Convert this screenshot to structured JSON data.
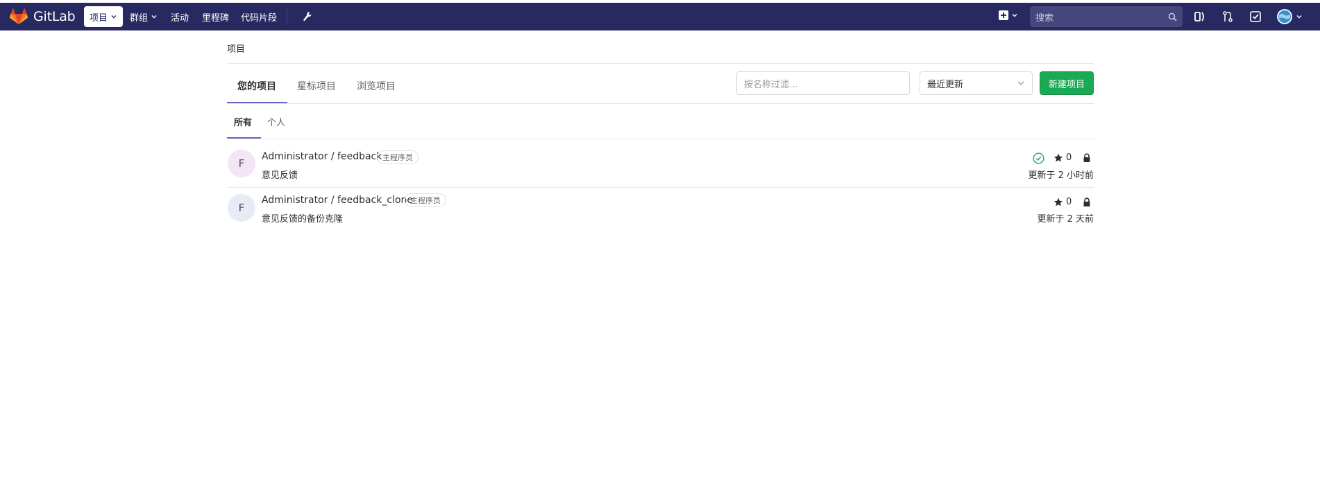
{
  "header": {
    "brand": "GitLab",
    "nav": [
      {
        "label": "项目"
      },
      {
        "label": "群组"
      },
      {
        "label": "活动"
      },
      {
        "label": "里程碑"
      },
      {
        "label": "代码片段"
      }
    ],
    "search_placeholder": "搜索",
    "colors": {
      "bar": "#292961",
      "search": "#46467d"
    }
  },
  "breadcrumb": "项目",
  "tabs": [
    {
      "label": "您的项目"
    },
    {
      "label": "星标项目"
    },
    {
      "label": "浏览项目"
    }
  ],
  "filter_placeholder": "按名称过滤...",
  "sort_selected": "最近更新",
  "new_project_label": "新建项目",
  "subtabs": [
    {
      "label": "所有"
    },
    {
      "label": "个人"
    }
  ],
  "projects": [
    {
      "avatar_letter": "F",
      "avatar_color": "#f3e5f5",
      "title": "Administrator / feedback",
      "role": "主程序员",
      "description": "意见反馈",
      "stars": "0",
      "pipeline_passed": true,
      "updated": "更新于 2 小时前"
    },
    {
      "avatar_letter": "F",
      "avatar_color": "#e8eaf6",
      "title": "Administrator / feedback_clone",
      "role": "主程序员",
      "description": "意见反馈的备份克隆",
      "stars": "0",
      "pipeline_passed": false,
      "updated": "更新于 2 天前"
    }
  ],
  "accent_color": "#1aaa55"
}
